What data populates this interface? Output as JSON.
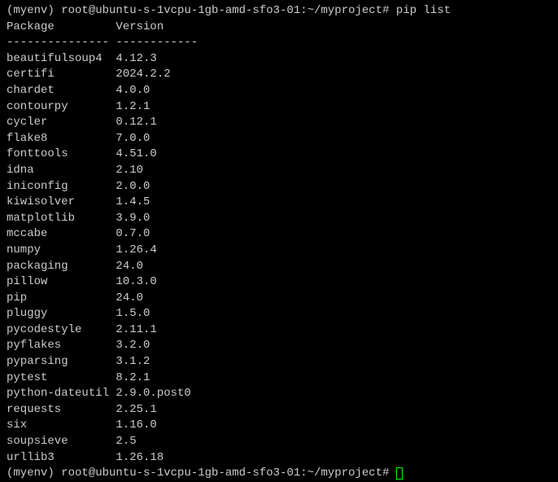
{
  "prompt1": {
    "venv": "(myenv)",
    "userhost": "root@ubuntu-s-1vcpu-1gb-amd-sfo3-01",
    "path": "~/myproject",
    "hash": "#",
    "command": "pip list"
  },
  "header": {
    "col1": "Package",
    "col2": "Version"
  },
  "separator": {
    "col1": "---------------",
    "col2": "------------"
  },
  "packages": [
    {
      "name": "beautifulsoup4",
      "version": "4.12.3"
    },
    {
      "name": "certifi",
      "version": "2024.2.2"
    },
    {
      "name": "chardet",
      "version": "4.0.0"
    },
    {
      "name": "contourpy",
      "version": "1.2.1"
    },
    {
      "name": "cycler",
      "version": "0.12.1"
    },
    {
      "name": "flake8",
      "version": "7.0.0"
    },
    {
      "name": "fonttools",
      "version": "4.51.0"
    },
    {
      "name": "idna",
      "version": "2.10"
    },
    {
      "name": "iniconfig",
      "version": "2.0.0"
    },
    {
      "name": "kiwisolver",
      "version": "1.4.5"
    },
    {
      "name": "matplotlib",
      "version": "3.9.0"
    },
    {
      "name": "mccabe",
      "version": "0.7.0"
    },
    {
      "name": "numpy",
      "version": "1.26.4"
    },
    {
      "name": "packaging",
      "version": "24.0"
    },
    {
      "name": "pillow",
      "version": "10.3.0"
    },
    {
      "name": "pip",
      "version": "24.0"
    },
    {
      "name": "pluggy",
      "version": "1.5.0"
    },
    {
      "name": "pycodestyle",
      "version": "2.11.1"
    },
    {
      "name": "pyflakes",
      "version": "3.2.0"
    },
    {
      "name": "pyparsing",
      "version": "3.1.2"
    },
    {
      "name": "pytest",
      "version": "8.2.1"
    },
    {
      "name": "python-dateutil",
      "version": "2.9.0.post0"
    },
    {
      "name": "requests",
      "version": "2.25.1"
    },
    {
      "name": "six",
      "version": "1.16.0"
    },
    {
      "name": "soupsieve",
      "version": "2.5"
    },
    {
      "name": "urllib3",
      "version": "1.26.18"
    }
  ],
  "prompt2": {
    "venv": "(myenv)",
    "userhost": "root@ubuntu-s-1vcpu-1gb-amd-sfo3-01",
    "path": "~/myproject",
    "hash": "#"
  }
}
